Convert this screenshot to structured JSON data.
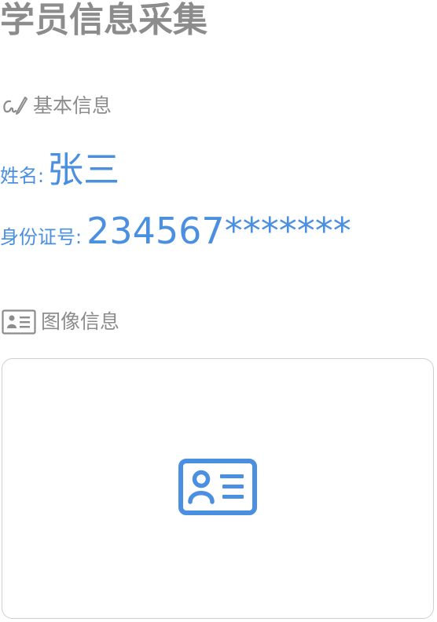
{
  "page": {
    "title": "学员信息采集"
  },
  "basic_info": {
    "header": "基本信息",
    "header_icon": "pen-signature-icon",
    "name_label": "姓名:",
    "name_value": "张三",
    "id_label": "身份证号:",
    "id_value": "234567*******"
  },
  "image_info": {
    "header": "图像信息",
    "header_icon": "id-card-icon",
    "upload_icon": "id-card-upload-icon"
  },
  "colors": {
    "accent": "#4a8fe0",
    "muted": "#8c8c8c",
    "border": "#cfcfcf"
  }
}
